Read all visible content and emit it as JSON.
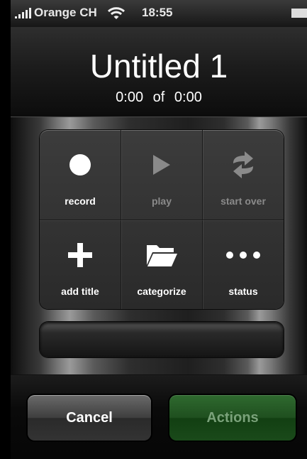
{
  "status_bar": {
    "carrier": "Orange CH",
    "time": "18:55",
    "icons": [
      "signal-icon",
      "wifi-icon",
      "battery-icon"
    ]
  },
  "header": {
    "title": "Untitled 1",
    "current_time": "0:00",
    "of_label": "of",
    "total_time": "0:00"
  },
  "grid": {
    "cells": [
      {
        "label": "record",
        "icon": "record-icon",
        "enabled": true
      },
      {
        "label": "play",
        "icon": "play-icon",
        "enabled": false
      },
      {
        "label": "start over",
        "icon": "start-over-icon",
        "enabled": false
      },
      {
        "label": "add title",
        "icon": "plus-icon",
        "enabled": true
      },
      {
        "label": "categorize",
        "icon": "folder-icon",
        "enabled": true
      },
      {
        "label": "status",
        "icon": "ellipsis-icon",
        "enabled": true
      }
    ]
  },
  "toolbar": {
    "cancel_label": "Cancel",
    "actions_label": "Actions"
  },
  "colors": {
    "actions_button": "#1f4f1f",
    "actions_text": "#7aa27a",
    "cancel_button": "#4a4a4a"
  }
}
